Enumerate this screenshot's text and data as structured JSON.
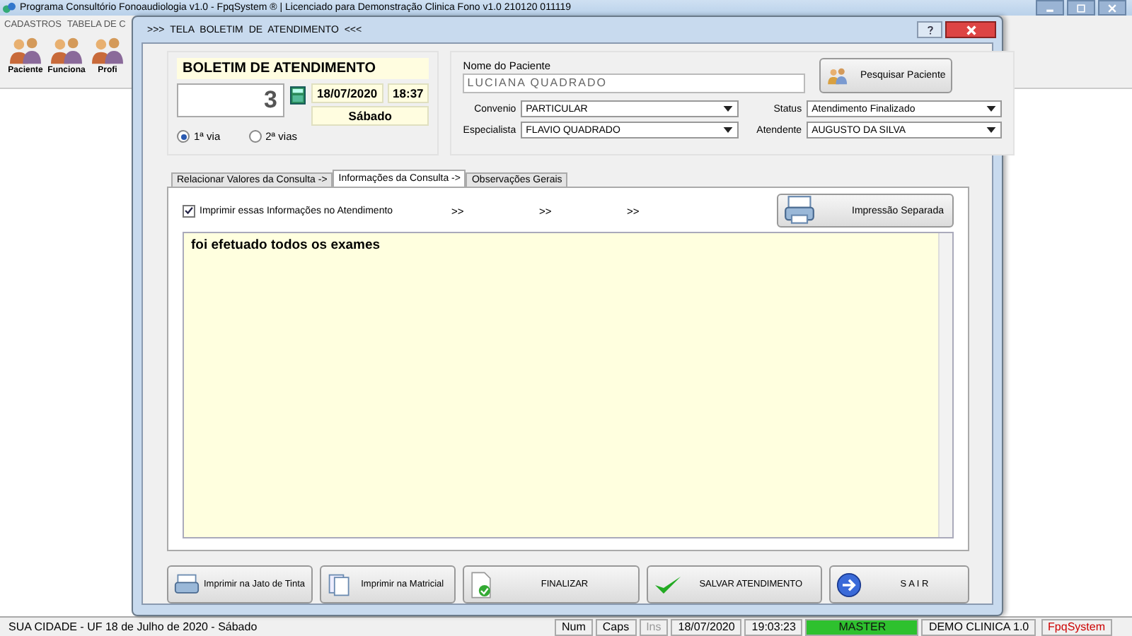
{
  "main_window": {
    "title": "Programa Consultório Fonoaudiologia v1.0 - FpqSystem ® | Licenciado para  Demonstração Clinica Fono v1.0 210120 011119",
    "menu": [
      "CADASTROS",
      "TABELA DE C"
    ],
    "toolbar": [
      {
        "label": "Paciente"
      },
      {
        "label": "Funciona"
      },
      {
        "label": "Profi"
      }
    ]
  },
  "dialog": {
    "title": ">>>  TELA BOLETIM DE ATENDIMENTO  <<<",
    "heading": "BOLETIM DE ATENDIMENTO",
    "number": "3",
    "date": "18/07/2020",
    "time": "18:37",
    "weekday": "Sábado",
    "copies": [
      {
        "label": "1ª via",
        "selected": true
      },
      {
        "label": "2ª vias",
        "selected": false
      }
    ],
    "patient": {
      "label": "Nome do Paciente",
      "value": "LUCIANA QUADRADO"
    },
    "search_button": "Pesquisar Paciente",
    "selects": [
      {
        "label": "Convenio",
        "value": "PARTICULAR"
      },
      {
        "label": "Status",
        "value": "Atendimento Finalizado"
      },
      {
        "label": "Especialista",
        "value": "FLAVIO QUADRADO"
      },
      {
        "label": "Atendente",
        "value": "AUGUSTO DA SILVA"
      }
    ],
    "tabs": [
      {
        "label": "Relacionar Valores da Consulta ->",
        "selected": false
      },
      {
        "label": "Informações da Consulta ->",
        "selected": true
      },
      {
        "label": "Observações Gerais",
        "selected": false
      }
    ],
    "print_info": {
      "label": "Imprimir essas Informações no Atendimento",
      "checked": true
    },
    "arrows": [
      ">>",
      ">>",
      ">>"
    ],
    "separate_print_button": "Impressão Separada",
    "notes": "foi efetuado todos os exames",
    "buttons": [
      {
        "kind": "inkjet",
        "label": "Imprimir na Jato de Tinta"
      },
      {
        "kind": "matrix",
        "label": "Imprimir na Matricial"
      },
      {
        "kind": "finish",
        "label": "FINALIZAR"
      },
      {
        "kind": "save",
        "label": "SALVAR  ATENDIMENTO"
      },
      {
        "kind": "exit",
        "label": "S A I R"
      }
    ]
  },
  "status_bar": {
    "location": "SUA CIDADE - UF 18 de Julho de 2020 - Sábado",
    "num": "Num",
    "caps": "Caps",
    "ins": "Ins",
    "date": "18/07/2020",
    "time": "19:03:23",
    "user": "MASTER",
    "edition": "DEMO CLINICA 1.0",
    "brand": "FpqSystem"
  }
}
